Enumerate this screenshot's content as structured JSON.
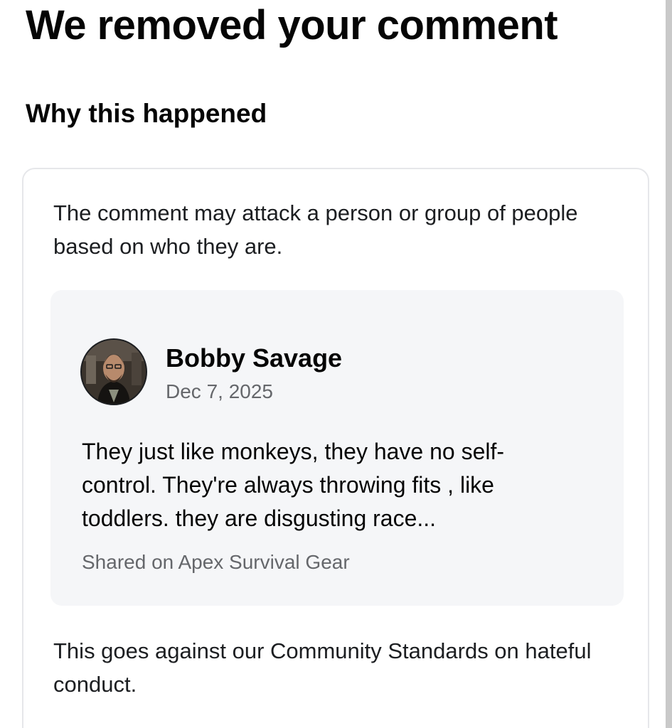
{
  "header": {
    "title": "We removed your comment"
  },
  "section": {
    "title": "Why this happened"
  },
  "card": {
    "reason": "The comment may attack a person or group of people based on who they are.",
    "comment": {
      "author": "Bobby Savage",
      "date": "Dec 7, 2025",
      "text": "They just like monkeys, they have no self-control. They're always throwing fits , like toddlers. they are disgusting race...",
      "source": "Shared on Apex Survival Gear"
    },
    "standards_note": "This goes against our Community Standards on hateful conduct."
  },
  "colors": {
    "text_primary": "#050505",
    "text_secondary": "#65676b",
    "comment_background": "#f5f6f8",
    "card_border": "#e6e7ea"
  }
}
